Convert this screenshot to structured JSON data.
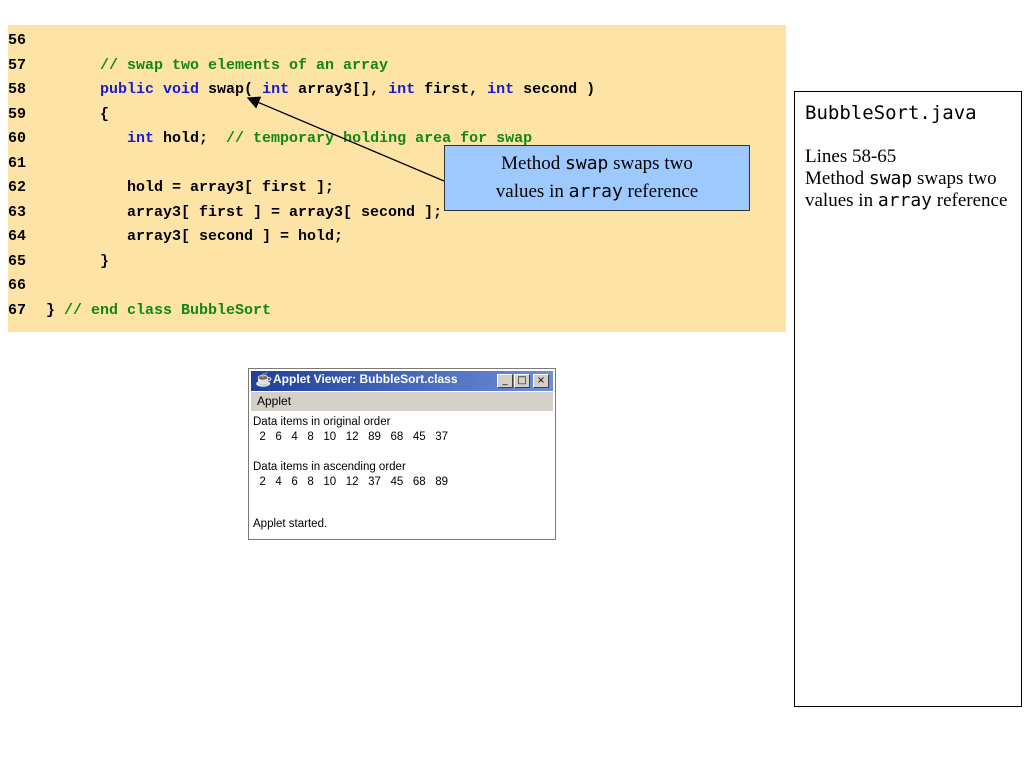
{
  "code": {
    "lines": [
      {
        "num": "56",
        "parts": []
      },
      {
        "num": "57",
        "parts": [
          {
            "t": "      ",
            "c": ""
          },
          {
            "t": "// swap two elements of an array",
            "c": "cm"
          }
        ]
      },
      {
        "num": "58",
        "parts": [
          {
            "t": "      ",
            "c": ""
          },
          {
            "t": "public void ",
            "c": "kw"
          },
          {
            "t": "swap( ",
            "c": ""
          },
          {
            "t": "int ",
            "c": "kw"
          },
          {
            "t": "array3[], ",
            "c": ""
          },
          {
            "t": "int ",
            "c": "kw"
          },
          {
            "t": "first, ",
            "c": ""
          },
          {
            "t": "int ",
            "c": "kw"
          },
          {
            "t": "second )",
            "c": ""
          }
        ]
      },
      {
        "num": "59",
        "parts": [
          {
            "t": "      {",
            "c": ""
          }
        ]
      },
      {
        "num": "60",
        "parts": [
          {
            "t": "         ",
            "c": ""
          },
          {
            "t": "int ",
            "c": "kw"
          },
          {
            "t": "hold;  ",
            "c": ""
          },
          {
            "t": "// temporary holding area for swap",
            "c": "cm"
          }
        ]
      },
      {
        "num": "61",
        "parts": []
      },
      {
        "num": "62",
        "parts": [
          {
            "t": "         hold = array3[ first ];",
            "c": ""
          }
        ]
      },
      {
        "num": "63",
        "parts": [
          {
            "t": "         array3[ first ] = array3[ second ];",
            "c": ""
          }
        ]
      },
      {
        "num": "64",
        "parts": [
          {
            "t": "         array3[ second ] = hold;",
            "c": ""
          }
        ]
      },
      {
        "num": "65",
        "parts": [
          {
            "t": "      }",
            "c": ""
          }
        ]
      },
      {
        "num": "66",
        "parts": []
      },
      {
        "num": "67",
        "parts": [
          {
            "t": "} ",
            "c": ""
          },
          {
            "t": "// end class BubbleSort",
            "c": "cm"
          }
        ]
      }
    ]
  },
  "callout": {
    "prefix": "Method ",
    "code1": "swap",
    "mid": " swaps two",
    "line2_prefix": "values in ",
    "code2": "array",
    "suffix": " reference"
  },
  "side_panel": {
    "file": "BubbleSort.java",
    "lines_label": "Lines 58-65",
    "desc_prefix": "Method ",
    "desc_code1": "swap",
    "desc_mid": " swaps two values in ",
    "desc_code2": "array",
    "desc_suffix": " reference"
  },
  "applet": {
    "title": "Applet Viewer: BubbleSort.class",
    "menu_label": "Applet",
    "body_text": "Data items in original order\n  2   6   4   8   10   12   89   68   45   37\n\nData items in ascending order\n  2   4   6   8   10   12   37   45   68   89",
    "status": "Applet started.",
    "minimize": "_",
    "maximize": "□",
    "close": "×"
  }
}
